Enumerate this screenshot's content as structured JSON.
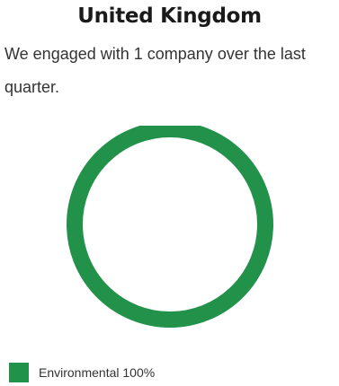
{
  "title": "United Kingdom",
  "summary": "We engaged with 1 company over the last quarter.",
  "chart_data": {
    "type": "pie",
    "style": "donut",
    "title": "United Kingdom",
    "slices": [
      {
        "label": "Environmental",
        "value": 100,
        "color": "#22924a"
      }
    ],
    "legend": [
      {
        "label": "Environmental",
        "percent_text": "100%"
      }
    ],
    "legend_position": "bottom-left"
  }
}
